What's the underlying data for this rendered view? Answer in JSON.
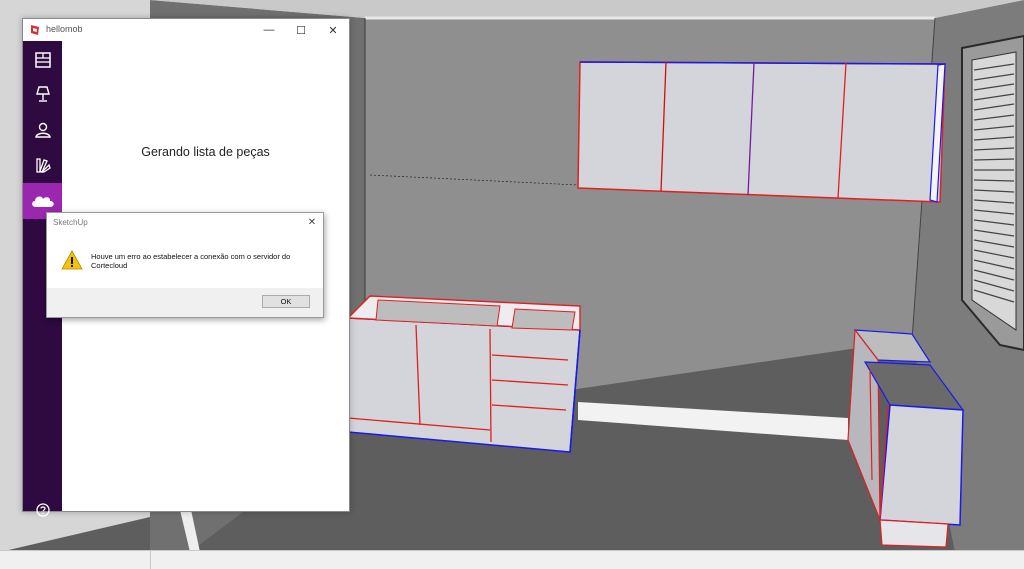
{
  "hellomob": {
    "title": "hellomob",
    "message": "Gerando lista de peças",
    "sidebar": {
      "items": [
        {
          "name": "list",
          "icon": "cabinet-list-icon"
        },
        {
          "name": "lamp",
          "icon": "lamp-icon"
        },
        {
          "name": "user",
          "icon": "user-icon"
        },
        {
          "name": "palette",
          "icon": "swatch-fan-icon"
        },
        {
          "name": "cloud",
          "icon": "cloud-icon",
          "active": true
        }
      ],
      "bottom_icon": "chat-help-icon"
    },
    "window_controls": {
      "minimize": "—",
      "maximize": "☐",
      "close": "✕"
    },
    "accent_color": "#9b27b0",
    "sidebar_color": "#2e0a40"
  },
  "dialog": {
    "title": "SketchUp",
    "message": "Houve um erro ao estabelecer a conexão com o servidor do Cortecloud",
    "ok_label": "OK",
    "close_label": "✕",
    "icon": "warning-icon"
  }
}
